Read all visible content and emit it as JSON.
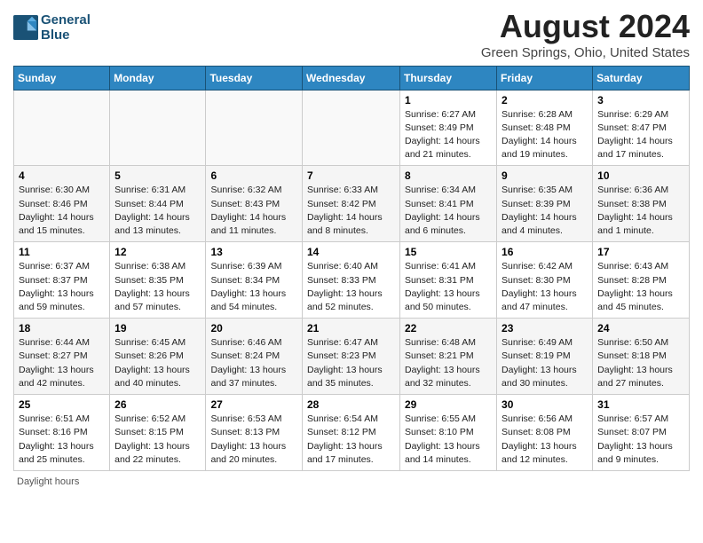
{
  "header": {
    "logo_line1": "General",
    "logo_line2": "Blue",
    "month_title": "August 2024",
    "location": "Green Springs, Ohio, United States"
  },
  "days_of_week": [
    "Sunday",
    "Monday",
    "Tuesday",
    "Wednesday",
    "Thursday",
    "Friday",
    "Saturday"
  ],
  "weeks": [
    [
      {
        "day": "",
        "info": ""
      },
      {
        "day": "",
        "info": ""
      },
      {
        "day": "",
        "info": ""
      },
      {
        "day": "",
        "info": ""
      },
      {
        "day": "1",
        "info": "Sunrise: 6:27 AM\nSunset: 8:49 PM\nDaylight: 14 hours\nand 21 minutes."
      },
      {
        "day": "2",
        "info": "Sunrise: 6:28 AM\nSunset: 8:48 PM\nDaylight: 14 hours\nand 19 minutes."
      },
      {
        "day": "3",
        "info": "Sunrise: 6:29 AM\nSunset: 8:47 PM\nDaylight: 14 hours\nand 17 minutes."
      }
    ],
    [
      {
        "day": "4",
        "info": "Sunrise: 6:30 AM\nSunset: 8:46 PM\nDaylight: 14 hours\nand 15 minutes."
      },
      {
        "day": "5",
        "info": "Sunrise: 6:31 AM\nSunset: 8:44 PM\nDaylight: 14 hours\nand 13 minutes."
      },
      {
        "day": "6",
        "info": "Sunrise: 6:32 AM\nSunset: 8:43 PM\nDaylight: 14 hours\nand 11 minutes."
      },
      {
        "day": "7",
        "info": "Sunrise: 6:33 AM\nSunset: 8:42 PM\nDaylight: 14 hours\nand 8 minutes."
      },
      {
        "day": "8",
        "info": "Sunrise: 6:34 AM\nSunset: 8:41 PM\nDaylight: 14 hours\nand 6 minutes."
      },
      {
        "day": "9",
        "info": "Sunrise: 6:35 AM\nSunset: 8:39 PM\nDaylight: 14 hours\nand 4 minutes."
      },
      {
        "day": "10",
        "info": "Sunrise: 6:36 AM\nSunset: 8:38 PM\nDaylight: 14 hours\nand 1 minute."
      }
    ],
    [
      {
        "day": "11",
        "info": "Sunrise: 6:37 AM\nSunset: 8:37 PM\nDaylight: 13 hours\nand 59 minutes."
      },
      {
        "day": "12",
        "info": "Sunrise: 6:38 AM\nSunset: 8:35 PM\nDaylight: 13 hours\nand 57 minutes."
      },
      {
        "day": "13",
        "info": "Sunrise: 6:39 AM\nSunset: 8:34 PM\nDaylight: 13 hours\nand 54 minutes."
      },
      {
        "day": "14",
        "info": "Sunrise: 6:40 AM\nSunset: 8:33 PM\nDaylight: 13 hours\nand 52 minutes."
      },
      {
        "day": "15",
        "info": "Sunrise: 6:41 AM\nSunset: 8:31 PM\nDaylight: 13 hours\nand 50 minutes."
      },
      {
        "day": "16",
        "info": "Sunrise: 6:42 AM\nSunset: 8:30 PM\nDaylight: 13 hours\nand 47 minutes."
      },
      {
        "day": "17",
        "info": "Sunrise: 6:43 AM\nSunset: 8:28 PM\nDaylight: 13 hours\nand 45 minutes."
      }
    ],
    [
      {
        "day": "18",
        "info": "Sunrise: 6:44 AM\nSunset: 8:27 PM\nDaylight: 13 hours\nand 42 minutes."
      },
      {
        "day": "19",
        "info": "Sunrise: 6:45 AM\nSunset: 8:26 PM\nDaylight: 13 hours\nand 40 minutes."
      },
      {
        "day": "20",
        "info": "Sunrise: 6:46 AM\nSunset: 8:24 PM\nDaylight: 13 hours\nand 37 minutes."
      },
      {
        "day": "21",
        "info": "Sunrise: 6:47 AM\nSunset: 8:23 PM\nDaylight: 13 hours\nand 35 minutes."
      },
      {
        "day": "22",
        "info": "Sunrise: 6:48 AM\nSunset: 8:21 PM\nDaylight: 13 hours\nand 32 minutes."
      },
      {
        "day": "23",
        "info": "Sunrise: 6:49 AM\nSunset: 8:19 PM\nDaylight: 13 hours\nand 30 minutes."
      },
      {
        "day": "24",
        "info": "Sunrise: 6:50 AM\nSunset: 8:18 PM\nDaylight: 13 hours\nand 27 minutes."
      }
    ],
    [
      {
        "day": "25",
        "info": "Sunrise: 6:51 AM\nSunset: 8:16 PM\nDaylight: 13 hours\nand 25 minutes."
      },
      {
        "day": "26",
        "info": "Sunrise: 6:52 AM\nSunset: 8:15 PM\nDaylight: 13 hours\nand 22 minutes."
      },
      {
        "day": "27",
        "info": "Sunrise: 6:53 AM\nSunset: 8:13 PM\nDaylight: 13 hours\nand 20 minutes."
      },
      {
        "day": "28",
        "info": "Sunrise: 6:54 AM\nSunset: 8:12 PM\nDaylight: 13 hours\nand 17 minutes."
      },
      {
        "day": "29",
        "info": "Sunrise: 6:55 AM\nSunset: 8:10 PM\nDaylight: 13 hours\nand 14 minutes."
      },
      {
        "day": "30",
        "info": "Sunrise: 6:56 AM\nSunset: 8:08 PM\nDaylight: 13 hours\nand 12 minutes."
      },
      {
        "day": "31",
        "info": "Sunrise: 6:57 AM\nSunset: 8:07 PM\nDaylight: 13 hours\nand 9 minutes."
      }
    ]
  ],
  "footer": "Daylight hours"
}
